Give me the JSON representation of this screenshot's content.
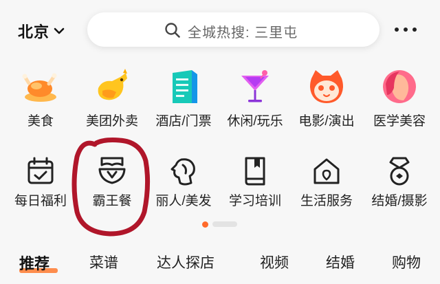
{
  "header": {
    "city": "北京",
    "search_placeholder": "全城热搜: 三里屯"
  },
  "categories_row1": [
    {
      "label": "美食",
      "icon": "roast-chicken-icon"
    },
    {
      "label": "美团外卖",
      "icon": "kangaroo-icon"
    },
    {
      "label": "酒店/门票",
      "icon": "hotel-building-icon"
    },
    {
      "label": "休闲/玩乐",
      "icon": "cocktail-icon"
    },
    {
      "label": "电影/演出",
      "icon": "cat-face-icon"
    },
    {
      "label": "医学美容",
      "icon": "woman-face-icon"
    }
  ],
  "categories_row2": [
    {
      "label": "每日福利",
      "icon": "calendar-check-icon"
    },
    {
      "label": "霸王餐",
      "icon": "crown-plate-icon"
    },
    {
      "label": "丽人/美发",
      "icon": "woman-profile-icon"
    },
    {
      "label": "学习培训",
      "icon": "book-icon"
    },
    {
      "label": "生活服务",
      "icon": "house-pin-icon"
    },
    {
      "label": "结婚/摄影",
      "icon": "diamond-ring-icon"
    }
  ],
  "tabs": [
    {
      "label": "推荐",
      "active": true
    },
    {
      "label": "菜谱",
      "active": false
    },
    {
      "label": "达人探店",
      "active": false
    },
    {
      "label": "视频",
      "active": false
    },
    {
      "label": "结婚",
      "active": false
    },
    {
      "label": "购物",
      "active": false
    }
  ],
  "colors": {
    "accent": "#ff6a2b",
    "annotation": "#b0162a",
    "background": "#f7f7f7"
  }
}
